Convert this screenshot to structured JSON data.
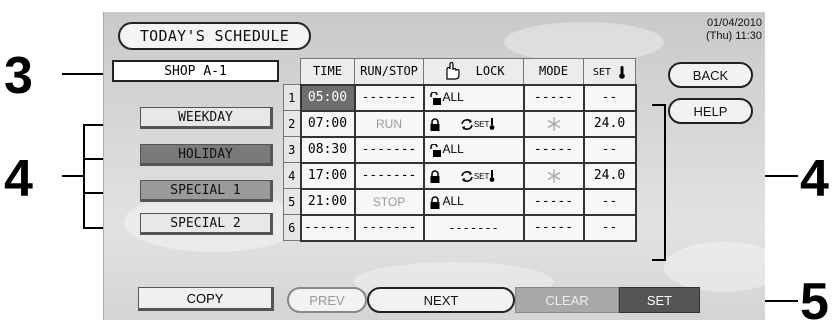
{
  "title": "TODAY'S SCHEDULE",
  "datetime": {
    "date": "01/04/2010",
    "time": "(Thu) 11:30"
  },
  "shop": "SHOP A-1",
  "callouts": {
    "c3": "3",
    "c4_left": "4",
    "c4_right": "4",
    "c5": "5"
  },
  "day_buttons": [
    "WEEKDAY",
    "HOLIDAY",
    "SPECIAL 1",
    "SPECIAL 2"
  ],
  "table": {
    "headers": {
      "time": "TIME",
      "run": "RUN/STOP",
      "lock": "LOCK",
      "mode": "MODE",
      "set": "SET"
    },
    "rows": [
      {
        "n": "1",
        "time": "05:00",
        "run": "-------",
        "lock": "ALL",
        "mode": "-----",
        "set": "--"
      },
      {
        "n": "2",
        "time": "07:00",
        "run": "RUN",
        "lock": "SET",
        "mode": "",
        "set": "24.0"
      },
      {
        "n": "3",
        "time": "08:30",
        "run": "-------",
        "lock": "ALL",
        "mode": "-----",
        "set": "--"
      },
      {
        "n": "4",
        "time": "17:00",
        "run": "-------",
        "lock": "SET",
        "mode": "",
        "set": "24.0"
      },
      {
        "n": "5",
        "time": "21:00",
        "run": "STOP",
        "lock": "ALL",
        "mode": "-----",
        "set": "--"
      },
      {
        "n": "6",
        "time": "------",
        "run": "-------",
        "lock": "-------",
        "mode": "-----",
        "set": "--"
      }
    ]
  },
  "buttons": {
    "back": "BACK",
    "help": "HELP",
    "copy": "COPY",
    "prev": "PREV",
    "next": "NEXT",
    "clear": "CLEAR",
    "set": "SET"
  },
  "icons": {
    "hand": "hand-pointer-icon",
    "lock_open": "lock-open-icon",
    "lock_closed": "lock-closed-icon",
    "rotate": "rotate-arrows-icon",
    "thermometer": "thermometer-icon",
    "snowflake": "snowflake-icon"
  }
}
